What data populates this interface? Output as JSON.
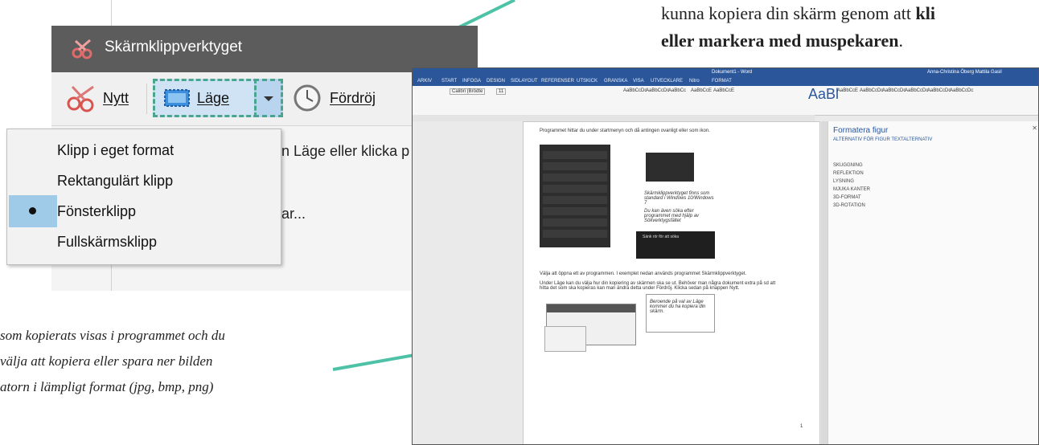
{
  "instructions": {
    "top_line1": "kunna kopiera din skärm genom att ",
    "top_bold1": "kli",
    "top_bold2": "eller markera med muspekaren",
    "top_end": ".",
    "bottom_line1": "som kopierats visas i programmet och du",
    "bottom_line2": "välja att  kopiera eller spara ner bilden",
    "bottom_line3": "atorn i lämpligt format (jpg, bmp, png)"
  },
  "snipping_tool": {
    "title": "Skärmklippverktyget",
    "new_label": "Nytt",
    "mode_label": "Läge",
    "delay_label": "Fördröj",
    "hint_text": "n Läge eller klicka p",
    "hint_text2": "ar..."
  },
  "mode_menu": {
    "items": [
      "Klipp i eget format",
      "Rektangulärt klipp",
      "Fönsterklipp",
      "Fullskärmsklipp"
    ],
    "selected": "Fönsterklipp"
  },
  "word": {
    "title": "Dokument1 - Word",
    "user": "Anna-Christina Öberg Mattila Gasil",
    "tabs": [
      "ARKIV",
      "START",
      "INFOGA",
      "DESIGN",
      "SIDLAYOUT",
      "REFERENSER",
      "UTSKICK",
      "GRANSKA",
      "VISA",
      "UTVECKLARE",
      "Nitro",
      "FORMAT"
    ],
    "font": "Calibri (Brödte",
    "font_size": "11",
    "styles": [
      "AaBbCcDc",
      "AaBbCcDc",
      "AaBbCc",
      "AaBbCcE",
      "AaBbCcE",
      "AaBl",
      "AaBbCcE",
      "AaBbCcDc",
      "AaBbCcDc",
      "AaBbCcDc",
      "AaBbCcDc",
      "AaBbCcDc"
    ],
    "page_text1": "Programmet hittar du under startmenyn och då antingen ovanligt eller som ikon.",
    "page_text2": "Välja att öppna ett av programmen. I exemplet nedan används programmet Skärmklippverktyget.",
    "page_text3": "Under Läge kan du välja hur din kopiering av skärmen ska se ut. Behöver man några dokument extra på sd att hitta det som ska kopieras kan man ändra detta under Fördröj. Klicka sedan på knappen Nytt.",
    "note1": "Skärmklippverktyget finns som standard i Windows 10/Windows 7",
    "note2": "Du kan även söka efter programmet med hjälp av Sökverktygsfältet",
    "note3": "Beroende på val av Läge kommer du ha kopiera din skärm.",
    "search_text": "Sänk rör för att söka",
    "page_number": "1",
    "pane_title": "Formatera figur",
    "pane_tabs": "ALTERNATIV FÖR FIGUR   TEXTALTERNATIV",
    "pane_items": [
      "SKUGGNING",
      "REFLEKTION",
      "LYSNING",
      "MJUKA KANTER",
      "3D-FORMAT",
      "3D-ROTATION"
    ]
  }
}
